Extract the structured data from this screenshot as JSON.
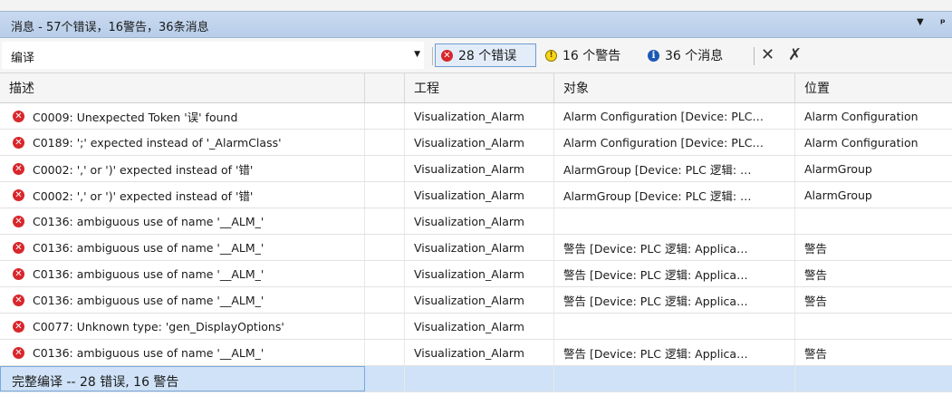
{
  "panel": {
    "title": "消息 - 57个错误，16警告，36条消息",
    "menu_arrow": "▼",
    "pin": "ᵖ"
  },
  "toolbar": {
    "source_value": "编译",
    "dropdown_arrow": "▼",
    "errors_label": "28 个错误",
    "warnings_label": "16 个警告",
    "messages_label": "36 个消息",
    "error_icon_glyph": "✕",
    "warning_icon_glyph": "!",
    "info_icon_glyph": "i",
    "clear_icon_glyph": "✕",
    "clear_all_icon_glyph": "✗"
  },
  "columns": {
    "description": "描述",
    "project": "工程",
    "object": "对象",
    "position": "位置"
  },
  "rows": [
    {
      "desc": "C0009: Unexpected Token '误' found",
      "project": "Visualization_Alarm",
      "object": "Alarm Configuration [Device: PLC…",
      "position": "Alarm Configuration"
    },
    {
      "desc": "C0189: ';' expected instead of '_AlarmClass'",
      "project": "Visualization_Alarm",
      "object": "Alarm Configuration [Device: PLC…",
      "position": "Alarm Configuration"
    },
    {
      "desc": "C0002: ',' or ')' expected instead of '错'",
      "project": "Visualization_Alarm",
      "object": "AlarmGroup [Device: PLC 逻辑: …",
      "position": "AlarmGroup"
    },
    {
      "desc": "C0002: ',' or ')' expected instead of '错'",
      "project": "Visualization_Alarm",
      "object": "AlarmGroup [Device: PLC 逻辑: …",
      "position": "AlarmGroup"
    },
    {
      "desc": "C0136: ambiguous use of name '__ALM_'",
      "project": "Visualization_Alarm",
      "object": "",
      "position": ""
    },
    {
      "desc": "C0136: ambiguous use of name '__ALM_'",
      "project": "Visualization_Alarm",
      "object": "警告 [Device: PLC 逻辑: Applica…",
      "position": "警告"
    },
    {
      "desc": "C0136: ambiguous use of name '__ALM_'",
      "project": "Visualization_Alarm",
      "object": "警告 [Device: PLC 逻辑: Applica…",
      "position": "警告"
    },
    {
      "desc": "C0136: ambiguous use of name '__ALM_'",
      "project": "Visualization_Alarm",
      "object": "警告 [Device: PLC 逻辑: Applica…",
      "position": "警告"
    },
    {
      "desc": "C0077: Unknown type: 'gen_DisplayOptions'",
      "project": "Visualization_Alarm",
      "object": "",
      "position": ""
    },
    {
      "desc": "C0136: ambiguous use of name '__ALM_'",
      "project": "Visualization_Alarm",
      "object": "警告 [Device: PLC 逻辑: Applica…",
      "position": "警告"
    }
  ],
  "summary_row": {
    "desc": "完整编译 -- 28 错误, 16 警告"
  },
  "colors": {
    "title_bar": "#c9daf0",
    "error_red": "#d8262b",
    "warning_yellow": "#f7d515",
    "info_blue": "#1d58b5",
    "selection": "#cfe2f7"
  }
}
